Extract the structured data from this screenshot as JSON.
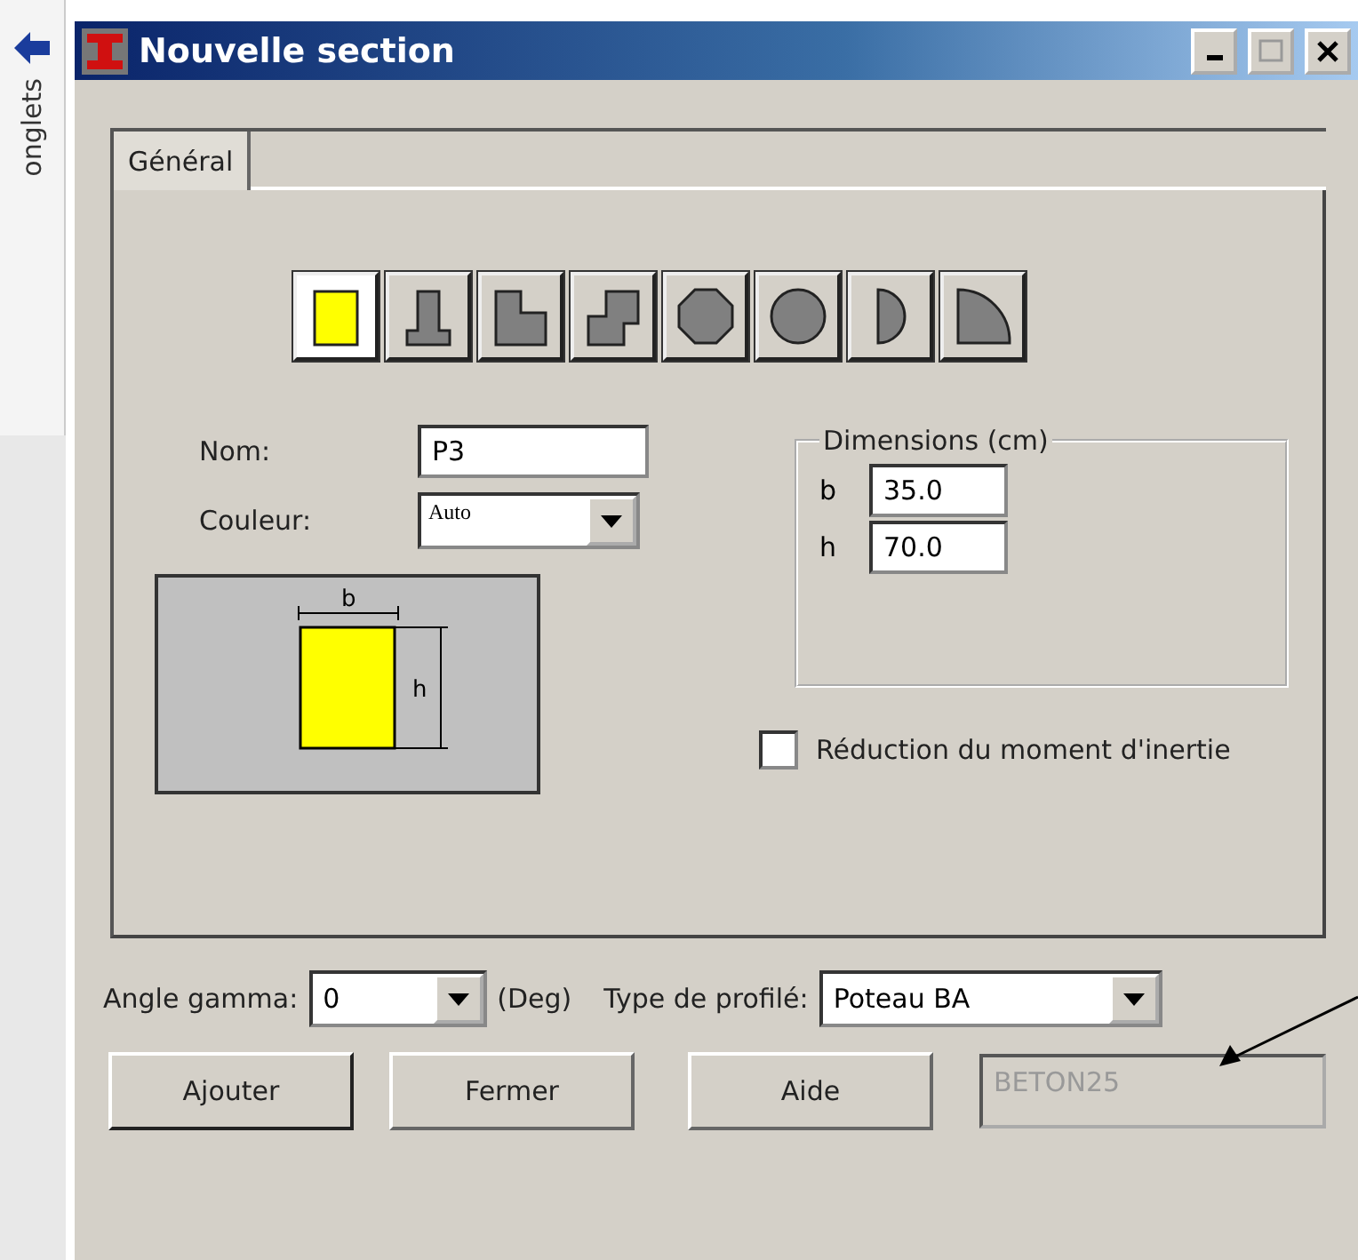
{
  "side_tab": {
    "label": "onglets"
  },
  "window": {
    "title": "Nouvelle section"
  },
  "tabs": [
    {
      "label": "Général",
      "selected": true
    }
  ],
  "shapes": [
    {
      "kind": "rectangle",
      "selected": true
    },
    {
      "kind": "t-section",
      "selected": false
    },
    {
      "kind": "l-section",
      "selected": false
    },
    {
      "kind": "z-section",
      "selected": false
    },
    {
      "kind": "octagon",
      "selected": false
    },
    {
      "kind": "circle",
      "selected": false
    },
    {
      "kind": "half-circle",
      "selected": false
    },
    {
      "kind": "quarter-circle",
      "selected": false
    }
  ],
  "nom": {
    "label": "Nom:",
    "value": "P3"
  },
  "couleur": {
    "label": "Couleur:",
    "value": "Auto"
  },
  "preview": {
    "width_label": "b",
    "height_label": "h"
  },
  "dimensions": {
    "title": "Dimensions (cm)",
    "fields": [
      {
        "label": "b",
        "value": "35.0"
      },
      {
        "label": "h",
        "value": "70.0"
      }
    ]
  },
  "inertia_reduction": {
    "label": "Réduction du moment d'inertie",
    "checked": false
  },
  "angle_gamma": {
    "label": "Angle gamma:",
    "value": "0",
    "unit": "(Deg)"
  },
  "profile_type": {
    "label": "Type de profilé:",
    "value": "Poteau BA"
  },
  "buttons": [
    {
      "label": "Ajouter",
      "default": true
    },
    {
      "label": "Fermer",
      "default": false
    },
    {
      "label": "Aide",
      "default": false
    }
  ],
  "material": {
    "value": "BETON25",
    "disabled": true
  }
}
